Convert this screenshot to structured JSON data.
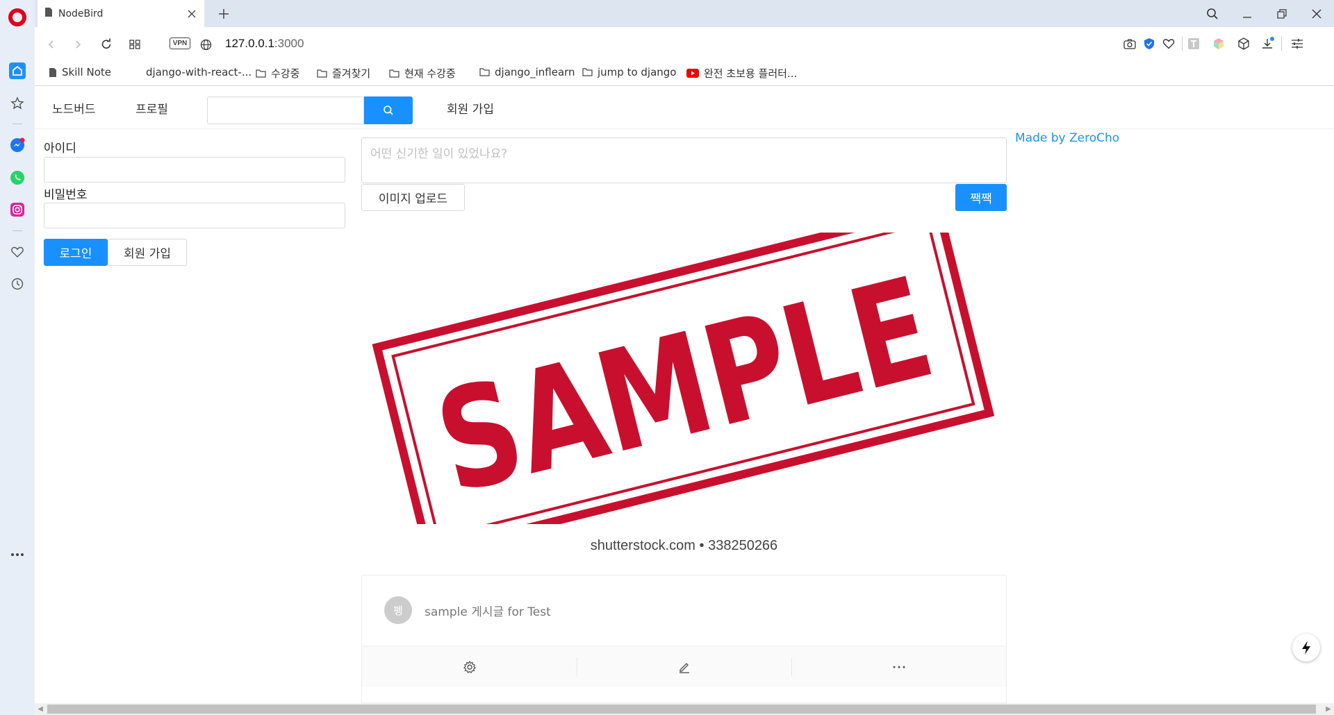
{
  "browser": {
    "tab_title": "NodeBird",
    "url_host": "127.0.0.1",
    "url_port": ":3000",
    "vpn_label": "VPN",
    "bookmarks": [
      {
        "label": "Skill Note",
        "icon": "page-icon"
      },
      {
        "label": "django-with-react-...",
        "icon": "none"
      },
      {
        "label": "수강중",
        "icon": "folder-icon"
      },
      {
        "label": "즐겨찾기",
        "icon": "folder-icon"
      },
      {
        "label": "현재 수강중",
        "icon": "folder-icon"
      },
      {
        "label": "django_inflearn",
        "icon": "folder-icon"
      },
      {
        "label": "jump to django",
        "icon": "folder-icon"
      },
      {
        "label": "완전 초보용 플러터...",
        "icon": "youtube-icon"
      }
    ],
    "accent_color": "#1890ff",
    "opera_red": "#e0001b"
  },
  "nav": {
    "home": "노드버드",
    "profile": "프로필",
    "signup": "회원 가입",
    "search_placeholder": ""
  },
  "login": {
    "id_label": "아이디",
    "id_value": "",
    "password_label": "비밀번호",
    "password_value": "",
    "login_button": "로그인",
    "signup_button": "회원 가입"
  },
  "post_form": {
    "placeholder": "어떤 신기한 일이 있었나요?",
    "upload_button": "이미지 업로드",
    "submit_button": "짹짹"
  },
  "sidebar_link": "Made by ZeroCho",
  "post": {
    "image_stamp_text": "SAMPLE",
    "image_caption": "shutterstock.com • 338250266",
    "avatar_letter": "펭",
    "content": "sample 게시글 for Test",
    "actions": [
      "setting-icon",
      "edit-icon",
      "ellipsis-icon"
    ]
  }
}
